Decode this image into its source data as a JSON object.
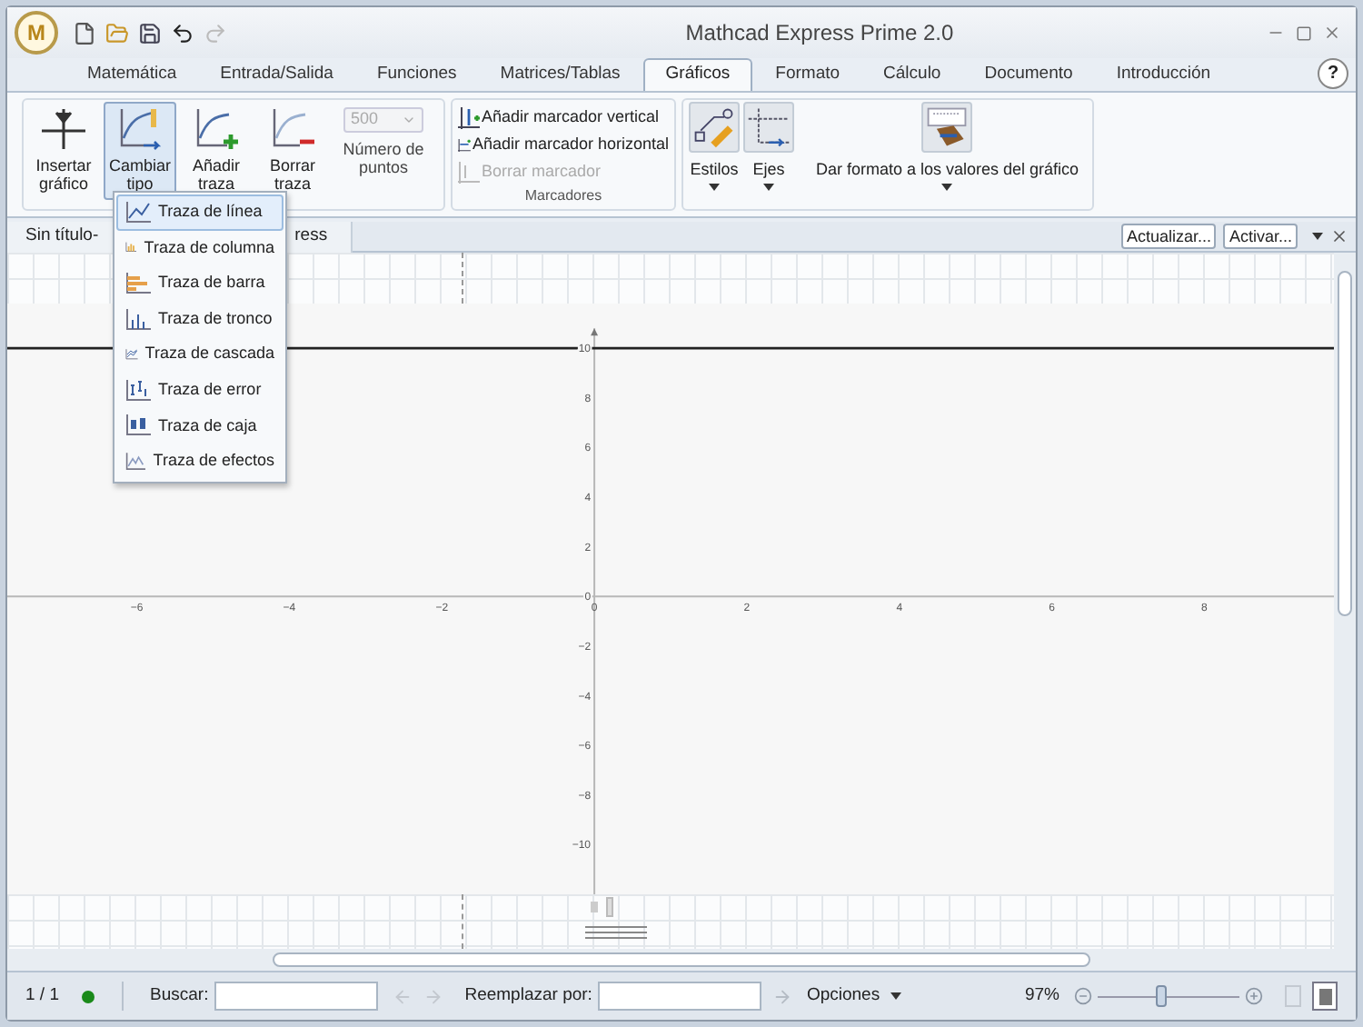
{
  "window": {
    "title": "Mathcad Express Prime 2.0",
    "logo_text": "M",
    "help": "?"
  },
  "ribbon_tabs": [
    {
      "label": "Matemática",
      "selected": false
    },
    {
      "label": "Entrada/Salida",
      "selected": false
    },
    {
      "label": "Funciones",
      "selected": false
    },
    {
      "label": "Matrices/Tablas",
      "selected": false
    },
    {
      "label": "Gráficos",
      "selected": true
    },
    {
      "label": "Formato",
      "selected": false
    },
    {
      "label": "Cálculo",
      "selected": false
    },
    {
      "label": "Documento",
      "selected": false
    },
    {
      "label": "Introducción",
      "selected": false
    }
  ],
  "ribbon": {
    "trace_buttons": [
      {
        "kind": "insert",
        "label": "Insertar gráfico",
        "pressed": false
      },
      {
        "kind": "change",
        "label": "Cambiar tipo",
        "pressed": true
      },
      {
        "kind": "add",
        "label": "Añadir traza",
        "pressed": false
      },
      {
        "kind": "remove",
        "label": "Borrar traza",
        "pressed": false
      }
    ],
    "points": {
      "value": "500",
      "label": "Número de puntos",
      "disabled": true
    },
    "markers": {
      "items": [
        {
          "kind": "vertical",
          "label": "Añadir marcador vertical",
          "disabled": false
        },
        {
          "kind": "horizontal",
          "label": "Añadir marcador horizontal",
          "disabled": false
        },
        {
          "kind": "remove",
          "label": "Borrar marcador",
          "disabled": true
        }
      ],
      "group_label": "Marcadores"
    },
    "style_buttons": [
      {
        "kind": "styles",
        "label": "Estilos"
      },
      {
        "kind": "axes",
        "label": "Ejes"
      },
      {
        "kind": "format",
        "label": "Dar formato a los valores del gráfico"
      }
    ]
  },
  "document_tab": {
    "title_start": "Sin título-",
    "title_end": "ress",
    "buttons": [
      "Actualizar...",
      "Activar..."
    ]
  },
  "plot_type_menu": [
    {
      "kind": "line",
      "label": "Traza de línea",
      "selected": true
    },
    {
      "kind": "column",
      "label": "Traza de columna",
      "selected": false
    },
    {
      "kind": "bar",
      "label": "Traza de barra",
      "selected": false
    },
    {
      "kind": "stem",
      "label": "Traza de tronco",
      "selected": false
    },
    {
      "kind": "waterfall",
      "label": "Traza de cascada",
      "selected": false
    },
    {
      "kind": "error",
      "label": "Traza de error",
      "selected": false
    },
    {
      "kind": "box",
      "label": "Traza de caja",
      "selected": false
    },
    {
      "kind": "effects",
      "label": "Traza de efectos",
      "selected": false
    }
  ],
  "plot": {
    "chart_data": {
      "type": "line",
      "xlim": [
        -7.7,
        9.7
      ],
      "ylim": [
        -12,
        11.8
      ],
      "xticks": [
        {
          "value": -6,
          "label": "−6"
        },
        {
          "value": -4,
          "label": "−4"
        },
        {
          "value": -2,
          "label": "−2"
        },
        0,
        2,
        4,
        6,
        8
      ],
      "yticks": [
        {
          "value": -10,
          "label": "−10"
        },
        {
          "value": -8,
          "label": "−8"
        },
        {
          "value": -6,
          "label": "−6"
        },
        {
          "value": -4,
          "label": "−4"
        },
        {
          "value": -2,
          "label": "−2"
        },
        0,
        2,
        4,
        6,
        8,
        10
      ],
      "x": [
        -7.7,
        9.7
      ],
      "series": [
        {
          "color": "#222222",
          "values": [
            10,
            10
          ]
        }
      ]
    }
  },
  "status_bar": {
    "page": "1 / 1",
    "find_label": "Buscar:",
    "replace_label": "Reemplazar por:",
    "options": "Opciones",
    "zoom": "97%",
    "zoom_level": {
      "level": 0.45
    }
  }
}
